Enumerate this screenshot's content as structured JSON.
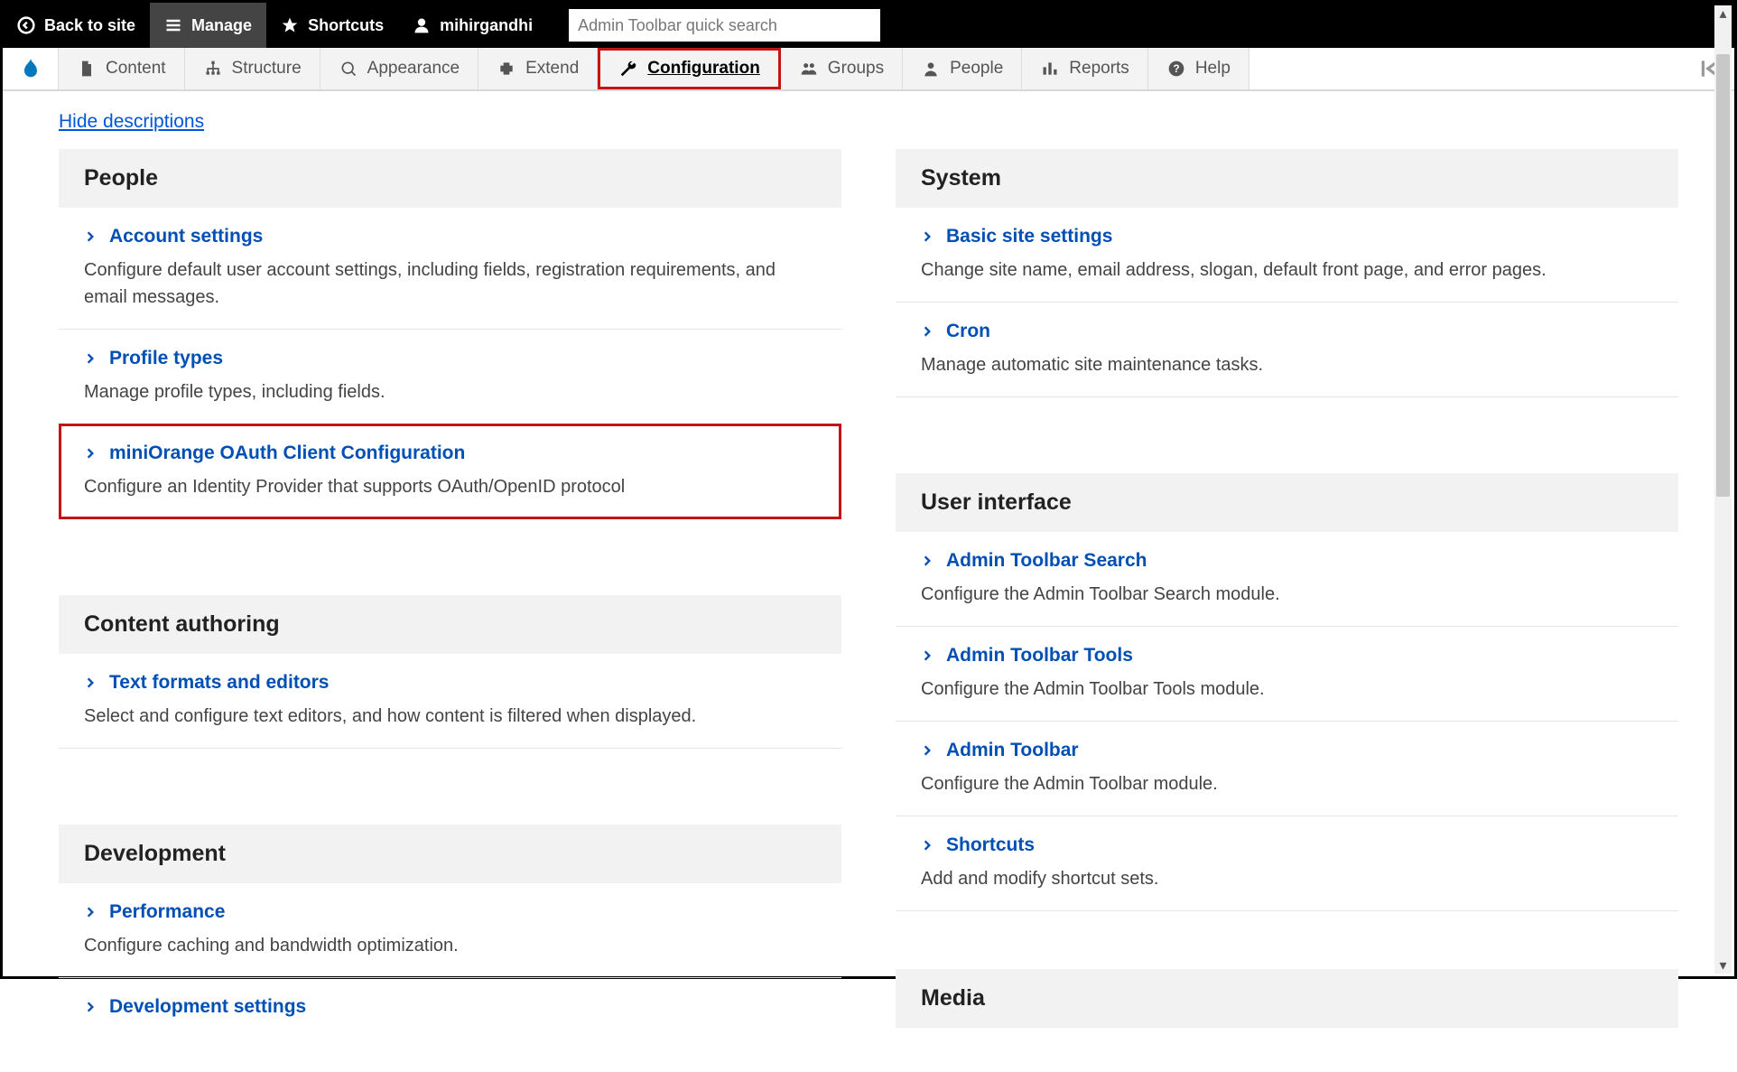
{
  "toolbar": {
    "back": "Back to site",
    "manage": "Manage",
    "shortcuts": "Shortcuts",
    "username": "mihirgandhi",
    "search_placeholder": "Admin Toolbar quick search"
  },
  "menu": {
    "content": "Content",
    "structure": "Structure",
    "appearance": "Appearance",
    "extend": "Extend",
    "configuration": "Configuration",
    "groups": "Groups",
    "people": "People",
    "reports": "Reports",
    "help": "Help"
  },
  "page": {
    "hide_descriptions": "Hide descriptions"
  },
  "left": [
    {
      "heading": "People",
      "items": [
        {
          "title": "Account settings",
          "desc": "Configure default user account settings, including fields, registration requirements, and email messages."
        },
        {
          "title": "Profile types",
          "desc": "Manage profile types, including fields."
        },
        {
          "title": "miniOrange OAuth Client Configuration",
          "desc": "Configure an Identity Provider that supports OAuth/OpenID protocol",
          "highlight": true
        }
      ]
    },
    {
      "heading": "Content authoring",
      "items": [
        {
          "title": "Text formats and editors",
          "desc": "Select and configure text editors, and how content is filtered when displayed."
        }
      ]
    },
    {
      "heading": "Development",
      "items": [
        {
          "title": "Performance",
          "desc": "Configure caching and bandwidth optimization."
        },
        {
          "title": "Development settings",
          "desc": ""
        }
      ]
    }
  ],
  "right": [
    {
      "heading": "System",
      "items": [
        {
          "title": "Basic site settings",
          "desc": "Change site name, email address, slogan, default front page, and error pages."
        },
        {
          "title": "Cron",
          "desc": "Manage automatic site maintenance tasks."
        }
      ]
    },
    {
      "heading": "User interface",
      "items": [
        {
          "title": "Admin Toolbar Search",
          "desc": "Configure the Admin Toolbar Search module."
        },
        {
          "title": "Admin Toolbar Tools",
          "desc": "Configure the Admin Toolbar Tools module."
        },
        {
          "title": "Admin Toolbar",
          "desc": "Configure the Admin Toolbar module."
        },
        {
          "title": "Shortcuts",
          "desc": "Add and modify shortcut sets."
        }
      ]
    },
    {
      "heading": "Media",
      "items": []
    }
  ]
}
